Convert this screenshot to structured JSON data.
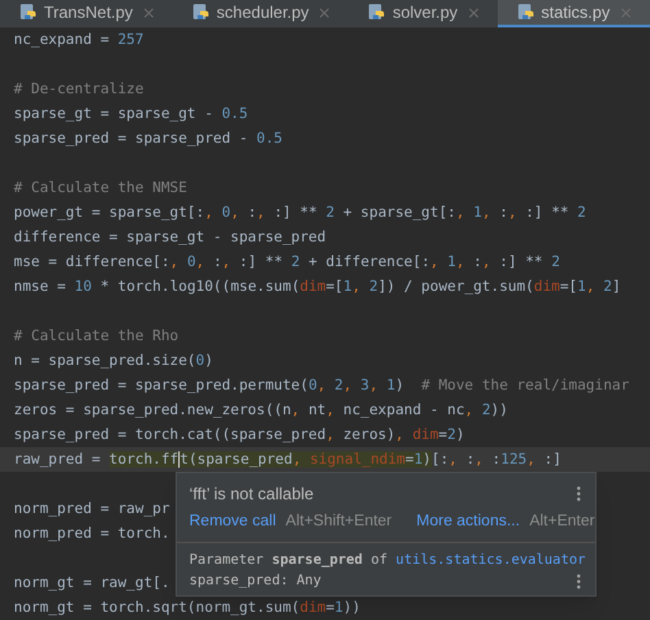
{
  "tabs": [
    {
      "label": "TransNet.py",
      "selected": false
    },
    {
      "label": "scheduler.py",
      "selected": false
    },
    {
      "label": "solver.py",
      "selected": false
    },
    {
      "label": "statics.py",
      "selected": true
    }
  ],
  "editor": {
    "lines": [
      {
        "current": false,
        "tokens": [
          {
            "text": "nc_expand = ",
            "kind": "plain"
          },
          {
            "text": "257",
            "kind": "number"
          }
        ]
      },
      {
        "current": false
      },
      {
        "current": false,
        "tokens": [
          {
            "text": "# De-centralize",
            "kind": "comment"
          }
        ]
      },
      {
        "current": false,
        "tokens": [
          {
            "text": "sparse_gt = sparse_gt - ",
            "kind": "plain"
          },
          {
            "text": "0.5",
            "kind": "number"
          }
        ]
      },
      {
        "current": false,
        "tokens": [
          {
            "text": "sparse_pred = sparse_pred - ",
            "kind": "plain"
          },
          {
            "text": "0.5",
            "kind": "number"
          }
        ]
      },
      {
        "current": false
      },
      {
        "current": false,
        "tokens": [
          {
            "text": "# Calculate the NMSE",
            "kind": "comment"
          }
        ]
      },
      {
        "current": false,
        "tokens": [
          {
            "text": "power_gt = sparse_gt[:",
            "kind": "plain"
          },
          {
            "text": ", ",
            "kind": "punct"
          },
          {
            "text": "0",
            "kind": "number"
          },
          {
            "text": ", ",
            "kind": "punct"
          },
          {
            "text": ":",
            "kind": "plain"
          },
          {
            "text": ", ",
            "kind": "punct"
          },
          {
            "text": ":] ** ",
            "kind": "plain"
          },
          {
            "text": "2",
            "kind": "number"
          },
          {
            "text": " + sparse_gt[:",
            "kind": "plain"
          },
          {
            "text": ", ",
            "kind": "punct"
          },
          {
            "text": "1",
            "kind": "number"
          },
          {
            "text": ", ",
            "kind": "punct"
          },
          {
            "text": ":",
            "kind": "plain"
          },
          {
            "text": ", ",
            "kind": "punct"
          },
          {
            "text": ":] ** ",
            "kind": "plain"
          },
          {
            "text": "2",
            "kind": "number"
          }
        ]
      },
      {
        "current": false,
        "tokens": [
          {
            "text": "difference = sparse_gt - sparse_pred",
            "kind": "plain"
          }
        ]
      },
      {
        "current": false,
        "tokens": [
          {
            "text": "mse = difference[:",
            "kind": "plain"
          },
          {
            "text": ", ",
            "kind": "punct"
          },
          {
            "text": "0",
            "kind": "number"
          },
          {
            "text": ", ",
            "kind": "punct"
          },
          {
            "text": ":",
            "kind": "plain"
          },
          {
            "text": ", ",
            "kind": "punct"
          },
          {
            "text": ":] ** ",
            "kind": "plain"
          },
          {
            "text": "2",
            "kind": "number"
          },
          {
            "text": " + difference[:",
            "kind": "plain"
          },
          {
            "text": ", ",
            "kind": "punct"
          },
          {
            "text": "1",
            "kind": "number"
          },
          {
            "text": ", ",
            "kind": "punct"
          },
          {
            "text": ":",
            "kind": "plain"
          },
          {
            "text": ", ",
            "kind": "punct"
          },
          {
            "text": ":] ** ",
            "kind": "plain"
          },
          {
            "text": "2",
            "kind": "number"
          }
        ]
      },
      {
        "current": false,
        "tokens": [
          {
            "text": "nmse = ",
            "kind": "plain"
          },
          {
            "text": "10",
            "kind": "number"
          },
          {
            "text": " * torch.log10((mse.sum(",
            "kind": "plain"
          },
          {
            "text": "dim",
            "kind": "kwarg"
          },
          {
            "text": "=[",
            "kind": "plain"
          },
          {
            "text": "1",
            "kind": "number"
          },
          {
            "text": ", ",
            "kind": "punct"
          },
          {
            "text": "2",
            "kind": "number"
          },
          {
            "text": "]) / power_gt.sum(",
            "kind": "plain"
          },
          {
            "text": "dim",
            "kind": "kwarg"
          },
          {
            "text": "=[",
            "kind": "plain"
          },
          {
            "text": "1",
            "kind": "number"
          },
          {
            "text": ", ",
            "kind": "punct"
          },
          {
            "text": "2",
            "kind": "number"
          },
          {
            "text": "]",
            "kind": "plain"
          }
        ]
      },
      {
        "current": false
      },
      {
        "current": false,
        "tokens": [
          {
            "text": "# Calculate the Rho",
            "kind": "comment"
          }
        ]
      },
      {
        "current": false,
        "tokens": [
          {
            "text": "n = sparse_pred.size(",
            "kind": "plain"
          },
          {
            "text": "0",
            "kind": "number"
          },
          {
            "text": ")",
            "kind": "plain"
          }
        ]
      },
      {
        "current": false,
        "tokens": [
          {
            "text": "sparse_pred = sparse_pred.permute(",
            "kind": "plain"
          },
          {
            "text": "0",
            "kind": "number"
          },
          {
            "text": ", ",
            "kind": "punct"
          },
          {
            "text": "2",
            "kind": "number"
          },
          {
            "text": ", ",
            "kind": "punct"
          },
          {
            "text": "3",
            "kind": "number"
          },
          {
            "text": ", ",
            "kind": "punct"
          },
          {
            "text": "1",
            "kind": "number"
          },
          {
            "text": ")  ",
            "kind": "plain"
          },
          {
            "text": "# Move the real/imaginar",
            "kind": "comment"
          }
        ]
      },
      {
        "current": false,
        "tokens": [
          {
            "text": "zeros = sparse_pred.new_zeros((n",
            "kind": "plain"
          },
          {
            "text": ", ",
            "kind": "punct"
          },
          {
            "text": "nt",
            "kind": "plain"
          },
          {
            "text": ", ",
            "kind": "punct"
          },
          {
            "text": "nc_expand - nc",
            "kind": "plain"
          },
          {
            "text": ", ",
            "kind": "punct"
          },
          {
            "text": "2",
            "kind": "number"
          },
          {
            "text": "))",
            "kind": "plain"
          }
        ]
      },
      {
        "current": false,
        "tokens": [
          {
            "text": "sparse_pred = torch.cat((sparse_pred",
            "kind": "plain"
          },
          {
            "text": ", ",
            "kind": "punct"
          },
          {
            "text": "zeros)",
            "kind": "plain"
          },
          {
            "text": ", ",
            "kind": "punct"
          },
          {
            "text": "dim",
            "kind": "kwarg"
          },
          {
            "text": "=",
            "kind": "plain"
          },
          {
            "text": "2",
            "kind": "number"
          },
          {
            "text": ")",
            "kind": "plain"
          }
        ]
      },
      {
        "current": true,
        "tokens": [
          {
            "text": "raw_pred = ",
            "kind": "plain"
          },
          {
            "text": "torch.ff",
            "kind": "plain",
            "highlighted": true,
            "caret": true
          },
          {
            "text": "t(sparse_pred",
            "kind": "plain",
            "highlighted": true
          },
          {
            "text": ", ",
            "kind": "punct",
            "highlighted": true
          },
          {
            "text": "signal_ndim",
            "kind": "kwarg",
            "highlighted": true
          },
          {
            "text": "=",
            "kind": "plain",
            "highlighted": true
          },
          {
            "text": "1",
            "kind": "number",
            "highlighted": true
          },
          {
            "text": ")",
            "kind": "plain",
            "highlighted": true
          },
          {
            "text": "[:",
            "kind": "plain"
          },
          {
            "text": ", ",
            "kind": "punct"
          },
          {
            "text": ":",
            "kind": "plain"
          },
          {
            "text": ", ",
            "kind": "punct"
          },
          {
            "text": ":",
            "kind": "plain"
          },
          {
            "text": "125",
            "kind": "number"
          },
          {
            "text": ", ",
            "kind": "punct"
          },
          {
            "text": ":]",
            "kind": "plain"
          }
        ]
      },
      {
        "current": false
      },
      {
        "current": false,
        "tokens": [
          {
            "text": "norm_pred = raw_pr",
            "kind": "plain"
          }
        ]
      },
      {
        "current": false,
        "tokens": [
          {
            "text": "norm_pred = torch.",
            "kind": "plain"
          }
        ]
      },
      {
        "current": false
      },
      {
        "current": false,
        "tokens": [
          {
            "text": "norm_gt = raw_gt[.",
            "kind": "plain"
          }
        ]
      },
      {
        "current": false,
        "tokens": [
          {
            "text": "norm_gt = torch.sqrt(norm_gt.sum(",
            "kind": "plain"
          },
          {
            "text": "dim",
            "kind": "kwarg"
          },
          {
            "text": "=",
            "kind": "plain"
          },
          {
            "text": "1",
            "kind": "number"
          },
          {
            "text": "))",
            "kind": "plain"
          }
        ]
      }
    ]
  },
  "popup": {
    "message": "‘fft’ is not callable",
    "actions": [
      {
        "label": "Remove call",
        "shortcut": "Alt+Shift+Enter"
      },
      {
        "label": "More actions...",
        "shortcut": "Alt+Enter"
      }
    ],
    "parameter_info": "Parameter **sparse_pred** of ",
    "parameter_link": "utils.statics.evaluator",
    "signature": "sparse_pred: Any"
  }
}
